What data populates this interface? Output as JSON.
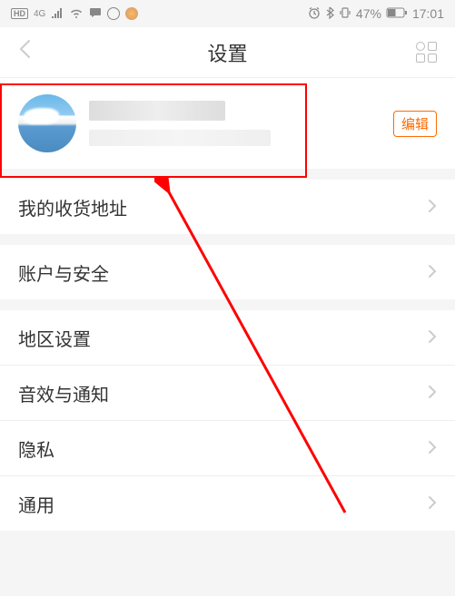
{
  "status": {
    "hd": "HD",
    "network": "4G",
    "battery_pct": "47%",
    "time": "17:01"
  },
  "header": {
    "title": "设置",
    "edit_label": "编辑"
  },
  "menu": {
    "shipping_address": "我的收货地址",
    "account_security": "账户与安全",
    "region": "地区设置",
    "sound_notify": "音效与通知",
    "privacy": "隐私",
    "general": "通用"
  },
  "icons": {
    "back": "back-icon",
    "grid": "grid-icon",
    "chevron": "chevron-right-icon",
    "alarm": "alarm-icon",
    "bluetooth": "bluetooth-icon",
    "signal": "signal-icon",
    "wifi": "wifi-icon",
    "chat": "chat-icon"
  },
  "annotation": {
    "highlight": "profile-highlight",
    "arrow": "red-arrow"
  }
}
